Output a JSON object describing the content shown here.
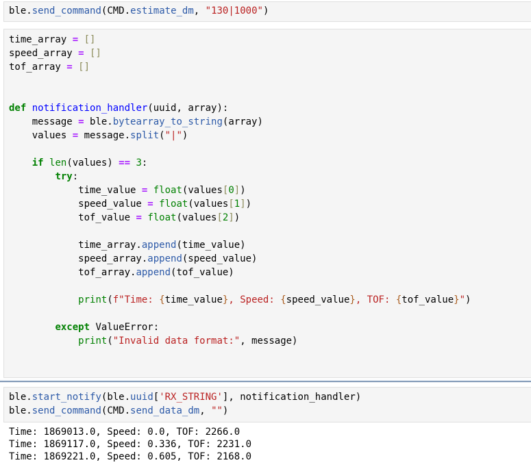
{
  "cells": [
    {
      "lines": [
        [
          [
            "n",
            "ble"
          ],
          [
            "p",
            "."
          ],
          [
            "a",
            "send_command"
          ],
          [
            "p",
            "("
          ],
          [
            "n",
            "CMD"
          ],
          [
            "p",
            "."
          ],
          [
            "a",
            "estimate_dm"
          ],
          [
            "p",
            ", "
          ],
          [
            "s",
            "\"130|1000\""
          ],
          [
            "p",
            ")"
          ]
        ]
      ]
    },
    {
      "lines": [
        [
          [
            "n",
            "time_array "
          ],
          [
            "o",
            "="
          ],
          [
            "p",
            " "
          ],
          [
            "b",
            "[]"
          ]
        ],
        [
          [
            "n",
            "speed_array "
          ],
          [
            "o",
            "="
          ],
          [
            "p",
            " "
          ],
          [
            "b",
            "[]"
          ]
        ],
        [
          [
            "n",
            "tof_array "
          ],
          [
            "o",
            "="
          ],
          [
            "p",
            " "
          ],
          [
            "b",
            "[]"
          ]
        ],
        [],
        [],
        [
          [
            "k",
            "def"
          ],
          [
            "p",
            " "
          ],
          [
            "d",
            "notification_handler"
          ],
          [
            "p",
            "(uuid, array):"
          ]
        ],
        [
          [
            "p",
            "    message "
          ],
          [
            "o",
            "="
          ],
          [
            "p",
            " ble."
          ],
          [
            "a",
            "bytearray_to_string"
          ],
          [
            "p",
            "(array)"
          ]
        ],
        [
          [
            "p",
            "    values "
          ],
          [
            "o",
            "="
          ],
          [
            "p",
            " message."
          ],
          [
            "a",
            "split"
          ],
          [
            "p",
            "("
          ],
          [
            "s",
            "\"|\""
          ],
          [
            "p",
            ")"
          ]
        ],
        [],
        [
          [
            "p",
            "    "
          ],
          [
            "k",
            "if"
          ],
          [
            "p",
            " "
          ],
          [
            "bi",
            "len"
          ],
          [
            "p",
            "(values) "
          ],
          [
            "o",
            "=="
          ],
          [
            "p",
            " "
          ],
          [
            "m",
            "3"
          ],
          [
            "p",
            ":"
          ]
        ],
        [
          [
            "p",
            "        "
          ],
          [
            "k",
            "try"
          ],
          [
            "p",
            ":"
          ]
        ],
        [
          [
            "p",
            "            time_value "
          ],
          [
            "o",
            "="
          ],
          [
            "p",
            " "
          ],
          [
            "bi",
            "float"
          ],
          [
            "p",
            "(values"
          ],
          [
            "b",
            "["
          ],
          [
            "m",
            "0"
          ],
          [
            "b",
            "]"
          ],
          [
            "p",
            ")"
          ]
        ],
        [
          [
            "p",
            "            speed_value "
          ],
          [
            "o",
            "="
          ],
          [
            "p",
            " "
          ],
          [
            "bi",
            "float"
          ],
          [
            "p",
            "(values"
          ],
          [
            "b",
            "["
          ],
          [
            "m",
            "1"
          ],
          [
            "b",
            "]"
          ],
          [
            "p",
            ")"
          ]
        ],
        [
          [
            "p",
            "            tof_value "
          ],
          [
            "o",
            "="
          ],
          [
            "p",
            " "
          ],
          [
            "bi",
            "float"
          ],
          [
            "p",
            "(values"
          ],
          [
            "b",
            "["
          ],
          [
            "m",
            "2"
          ],
          [
            "b",
            "]"
          ],
          [
            "p",
            ")"
          ]
        ],
        [],
        [
          [
            "p",
            "            time_array."
          ],
          [
            "a",
            "append"
          ],
          [
            "p",
            "(time_value)"
          ]
        ],
        [
          [
            "p",
            "            speed_array."
          ],
          [
            "a",
            "append"
          ],
          [
            "p",
            "(speed_value)"
          ]
        ],
        [
          [
            "p",
            "            tof_array."
          ],
          [
            "a",
            "append"
          ],
          [
            "p",
            "(tof_value)"
          ]
        ],
        [],
        [
          [
            "p",
            "            "
          ],
          [
            "bi",
            "print"
          ],
          [
            "p",
            "("
          ],
          [
            "s",
            "f\"Time: "
          ],
          [
            "f",
            "{"
          ],
          [
            "p",
            "time_value"
          ],
          [
            "f",
            "}"
          ],
          [
            "s",
            ", Speed: "
          ],
          [
            "f",
            "{"
          ],
          [
            "p",
            "speed_value"
          ],
          [
            "f",
            "}"
          ],
          [
            "s",
            ", TOF: "
          ],
          [
            "f",
            "{"
          ],
          [
            "p",
            "tof_value"
          ],
          [
            "f",
            "}"
          ],
          [
            "s",
            "\""
          ],
          [
            "p",
            ")"
          ]
        ],
        [],
        [
          [
            "p",
            "        "
          ],
          [
            "k",
            "except"
          ],
          [
            "p",
            " ValueError:"
          ]
        ],
        [
          [
            "p",
            "            "
          ],
          [
            "bi",
            "print"
          ],
          [
            "p",
            "("
          ],
          [
            "s",
            "\"Invalid data format:\""
          ],
          [
            "p",
            ", message)"
          ]
        ]
      ]
    },
    {
      "lines": [
        [
          [
            "n",
            "ble"
          ],
          [
            "p",
            "."
          ],
          [
            "a",
            "start_notify"
          ],
          [
            "p",
            "(ble."
          ],
          [
            "a",
            "uuid"
          ],
          [
            "p",
            "["
          ],
          [
            "s",
            "'RX_STRING'"
          ],
          [
            "p",
            "], notification_handler)"
          ]
        ],
        [
          [
            "n",
            "ble"
          ],
          [
            "p",
            "."
          ],
          [
            "a",
            "send_command"
          ],
          [
            "p",
            "(CMD."
          ],
          [
            "a",
            "send_data_dm"
          ],
          [
            "p",
            ", "
          ],
          [
            "s",
            "\"\""
          ],
          [
            "p",
            ")"
          ]
        ]
      ]
    }
  ],
  "output_lines": [
    "Time: 1869013.0, Speed: 0.0, TOF: 2266.0",
    "Time: 1869117.0, Speed: 0.336, TOF: 2231.0",
    "Time: 1869221.0, Speed: 0.605, TOF: 2168.0"
  ]
}
